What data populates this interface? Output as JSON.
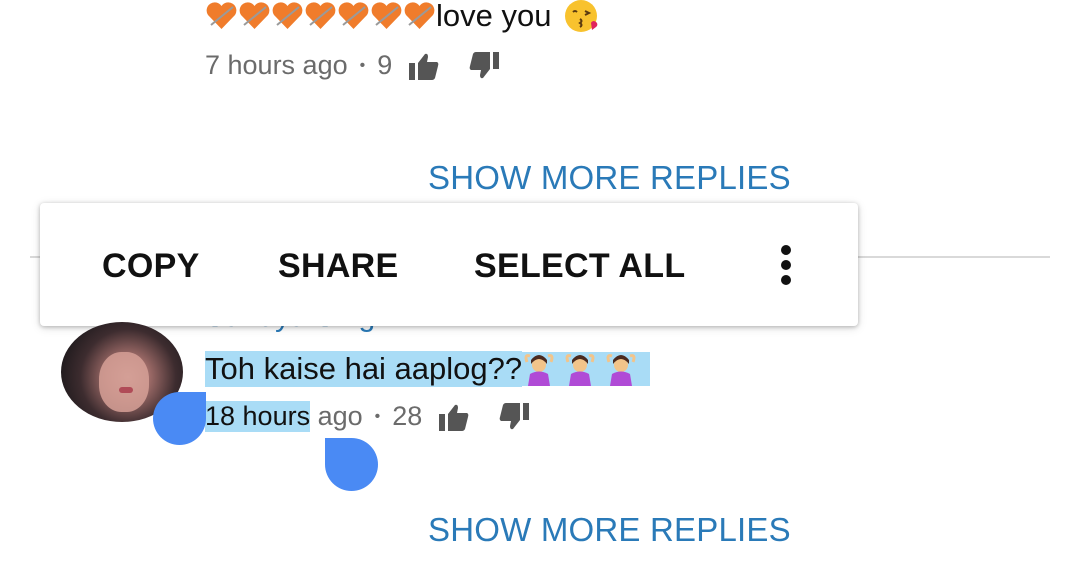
{
  "top_reply": {
    "text": "love you",
    "emoji": "kissing-face-icon",
    "heart_count": 7,
    "timestamp": "7 hours ago",
    "likes": "9"
  },
  "show_more_1": "SHOW MORE REPLIES",
  "context_menu": {
    "copy": "COPY",
    "share": "SHARE",
    "select_all": "SELECT ALL",
    "more": "more-options-icon"
  },
  "comment": {
    "author": "Sandya Singh",
    "text": "Toh kaise hai aaplog??",
    "timestamp_selected": "18 hours",
    "timestamp_rest": " ago",
    "likes": "28"
  },
  "show_more_2": "SHOW MORE REPLIES",
  "colors": {
    "link": "#2a7ab8",
    "selection": "#a9dcf6",
    "handle": "#4a8af4"
  }
}
